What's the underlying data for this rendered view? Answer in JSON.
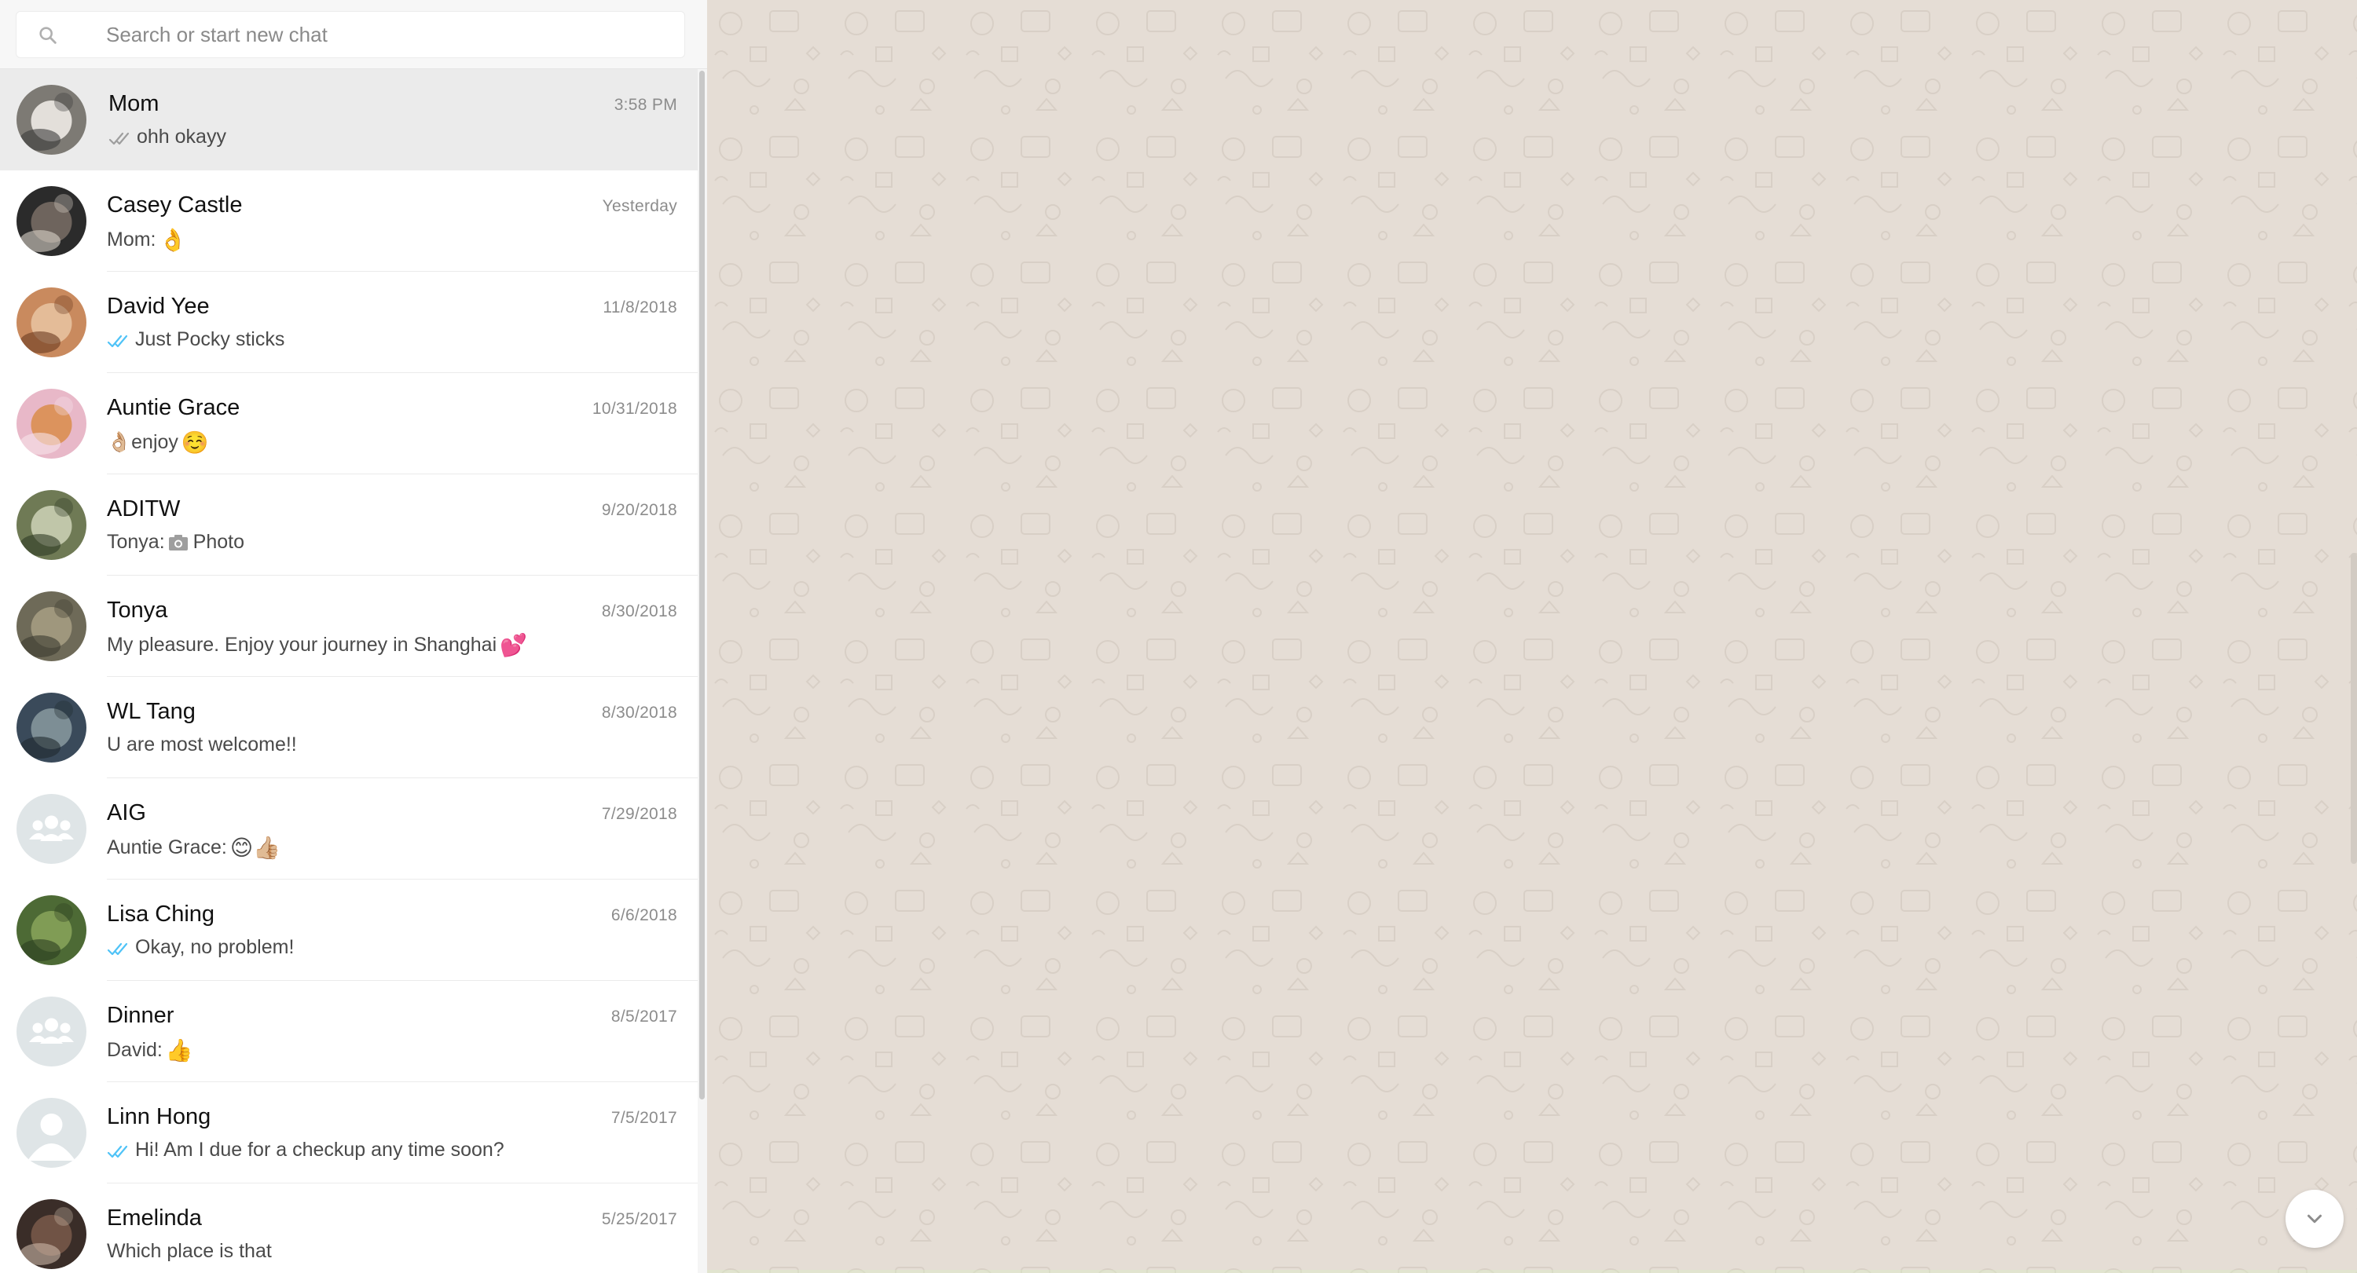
{
  "search": {
    "placeholder": "Search or start new chat",
    "icon": "search-icon"
  },
  "chats": [
    {
      "name": "Mom",
      "time": "3:58 PM",
      "ticks": "read-grey",
      "preview_prefix": "",
      "preview": "ohh okayy",
      "emoji": "",
      "active": true,
      "avatar": "dog-white"
    },
    {
      "name": "Casey Castle",
      "time": "Yesterday",
      "ticks": "",
      "preview_prefix": "Mom:",
      "preview": "",
      "emoji": "👌",
      "active": false,
      "avatar": "photo-dark"
    },
    {
      "name": "David Yee",
      "time": "11/8/2018",
      "ticks": "read-blue",
      "preview_prefix": "",
      "preview": "Just Pocky sticks",
      "emoji": "",
      "active": false,
      "avatar": "photo-orange"
    },
    {
      "name": "Auntie Grace",
      "time": "10/31/2018",
      "ticks": "",
      "preview_prefix": "👌🏼",
      "preview": "enjoy",
      "emoji": "☺️",
      "active": false,
      "avatar": "dog-pink"
    },
    {
      "name": "ADITW",
      "time": "9/20/2018",
      "ticks": "",
      "preview_prefix": "Tonya:",
      "preview": "Photo",
      "emoji": "",
      "camera": true,
      "active": false,
      "avatar": "photo-green"
    },
    {
      "name": "Tonya",
      "time": "8/30/2018",
      "ticks": "",
      "preview_prefix": "",
      "preview": "My pleasure. Enjoy your journey in Shanghai",
      "emoji": "💕",
      "active": false,
      "avatar": "photo-forest"
    },
    {
      "name": "WL Tang",
      "time": "8/30/2018",
      "ticks": "",
      "preview_prefix": "",
      "preview": "U are most welcome!!",
      "emoji": "",
      "active": false,
      "avatar": "photo-lake"
    },
    {
      "name": "AIG",
      "time": "7/29/2018",
      "ticks": "",
      "preview_prefix": "Auntie Grace:",
      "preview": "",
      "emoji": "😊👍🏼",
      "active": false,
      "avatar": "group-default"
    },
    {
      "name": "Lisa Ching",
      "time": "6/6/2018",
      "ticks": "read-blue",
      "preview_prefix": "",
      "preview": "Okay, no problem!",
      "emoji": "",
      "active": false,
      "avatar": "photo-trees"
    },
    {
      "name": "Dinner",
      "time": "8/5/2017",
      "ticks": "",
      "preview_prefix": "David:",
      "preview": "",
      "emoji": "👍",
      "active": false,
      "avatar": "group-default"
    },
    {
      "name": "Linn Hong",
      "time": "7/5/2017",
      "ticks": "read-blue",
      "preview_prefix": "",
      "preview": "Hi! Am I due for a checkup any time soon?",
      "emoji": "",
      "active": false,
      "avatar": "user-default"
    },
    {
      "name": "Emelinda",
      "time": "5/25/2017",
      "ticks": "",
      "preview_prefix": "",
      "preview": "Which place is that",
      "emoji": "",
      "active": false,
      "avatar": "photo-street"
    }
  ],
  "main": {
    "scroll_button_icon": "chevron-down-icon"
  },
  "colors": {
    "sidebar_bg": "#ffffff",
    "active_chat_bg": "#ebebeb",
    "wallpaper_bg": "#e5ddd5",
    "read_tick_blue": "#4fc3f7",
    "read_tick_grey": "#9e9e9e"
  }
}
